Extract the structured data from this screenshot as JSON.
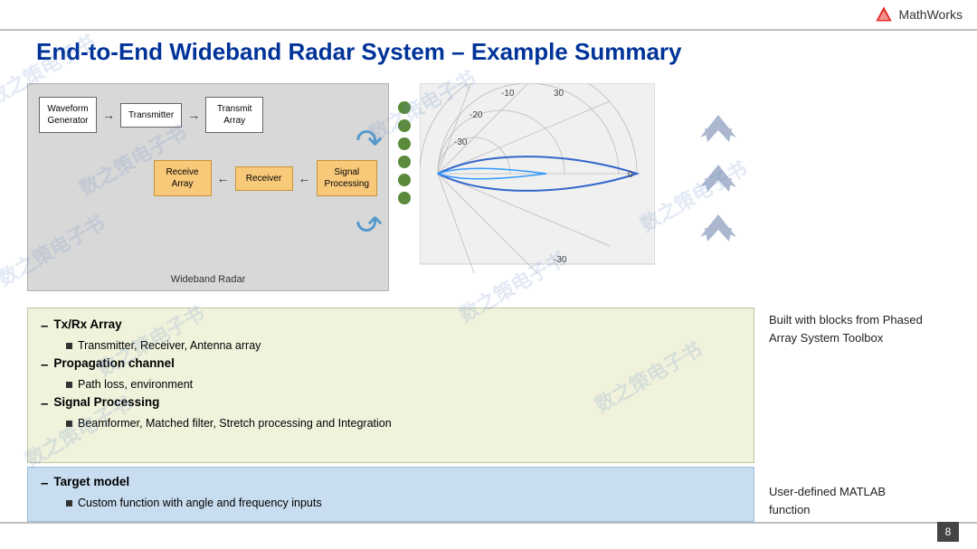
{
  "header": {
    "logo_text": "MathWorks",
    "title": "End-to-End Wideband Radar System – Example Summary"
  },
  "diagram": {
    "label": "Wideband Radar",
    "row1": [
      {
        "id": "waveform",
        "text": "Waveform\nGenerator",
        "type": "white"
      },
      {
        "id": "transmitter",
        "text": "Transmitter",
        "type": "white"
      },
      {
        "id": "transmit_array",
        "text": "Transmit\nArray",
        "type": "white"
      }
    ],
    "row2": [
      {
        "id": "signal_proc",
        "text": "Signal\nProcessing",
        "type": "orange"
      },
      {
        "id": "receiver",
        "text": "Receiver",
        "type": "orange"
      },
      {
        "id": "receive_array",
        "text": "Receive\nArray",
        "type": "orange"
      }
    ]
  },
  "polar": {
    "labels": {
      "-10": "-10",
      "-20": "-20",
      "-30": "-30",
      "30": "30",
      "0": "0",
      "-30b": "-30"
    }
  },
  "bullet_list": {
    "items": [
      {
        "dash": "–",
        "text": "Tx/Rx Array",
        "sub": [
          "Transmitter,  Receiver, Antenna array"
        ]
      },
      {
        "dash": "–",
        "text": "Propagation channel",
        "sub": [
          "Path loss, environment"
        ]
      },
      {
        "dash": "–",
        "text": "Signal Processing",
        "sub": [
          "Beamformer, Matched filter, Stretch processing and Integration"
        ]
      }
    ]
  },
  "target_model": {
    "dash": "–",
    "title": "Target model",
    "sub": "Custom function with angle and frequency inputs"
  },
  "right_texts": {
    "top": "Built with blocks from Phased\nArray System Toolbox",
    "bottom": "User-defined MATLAB\nfunction"
  },
  "page_number": "8"
}
